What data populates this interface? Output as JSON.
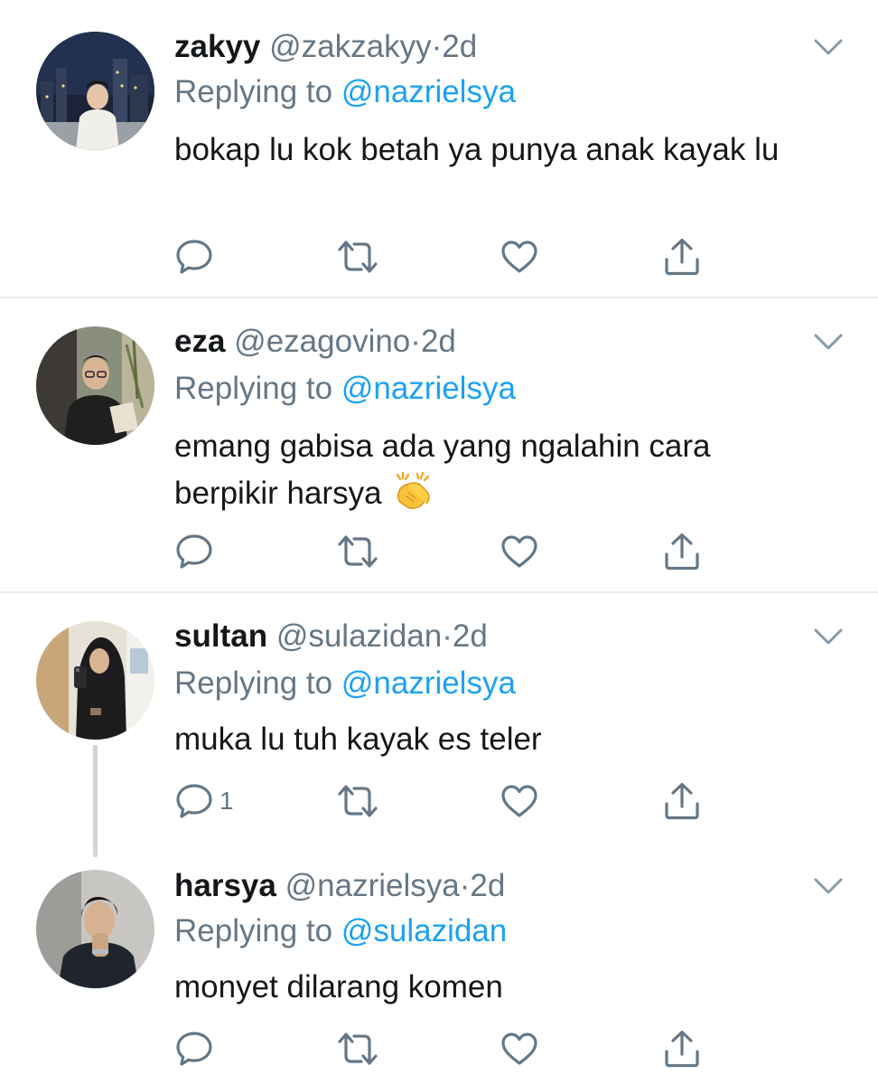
{
  "colors": {
    "text": "#14171a",
    "secondary": "#657786",
    "link": "#1da1f2",
    "divider": "#e6ecf0",
    "thread_line": "#ccd6dd"
  },
  "tweets": [
    {
      "name": "zakyy",
      "handle": "@zakzakyy",
      "dot": "·",
      "time": "2d",
      "replying_prefix": "Replying to ",
      "replying_to": "@nazrielsya",
      "text": "bokap lu kok betah ya punya anak kayak lu",
      "reply_count": "",
      "avatar_icon": "avatar-city-night"
    },
    {
      "name": "eza",
      "handle": "@ezagovino",
      "dot": "·",
      "time": "2d",
      "replying_prefix": "Replying to ",
      "replying_to": "@nazrielsya",
      "text": "emang gabisa ada yang ngalahin cara berpikir harsya",
      "emoji": "clapping-hands-emoji",
      "reply_count": "",
      "avatar_icon": "avatar-glasses-portrait"
    },
    {
      "name": "sultan",
      "handle": "@sulazidan",
      "dot": "·",
      "time": "2d",
      "replying_prefix": "Replying to ",
      "replying_to": "@nazrielsya",
      "text": "muka lu tuh kayak es teler",
      "reply_count": "1",
      "avatar_icon": "avatar-mirror-selfie"
    },
    {
      "name": "harsya",
      "handle": "@nazrielsya",
      "dot": "·",
      "time": "2d",
      "replying_prefix": "Replying to ",
      "replying_to": "@sulazidan",
      "text": "monyet dilarang komen",
      "reply_count": "",
      "avatar_icon": "avatar-dark-portrait"
    }
  ]
}
